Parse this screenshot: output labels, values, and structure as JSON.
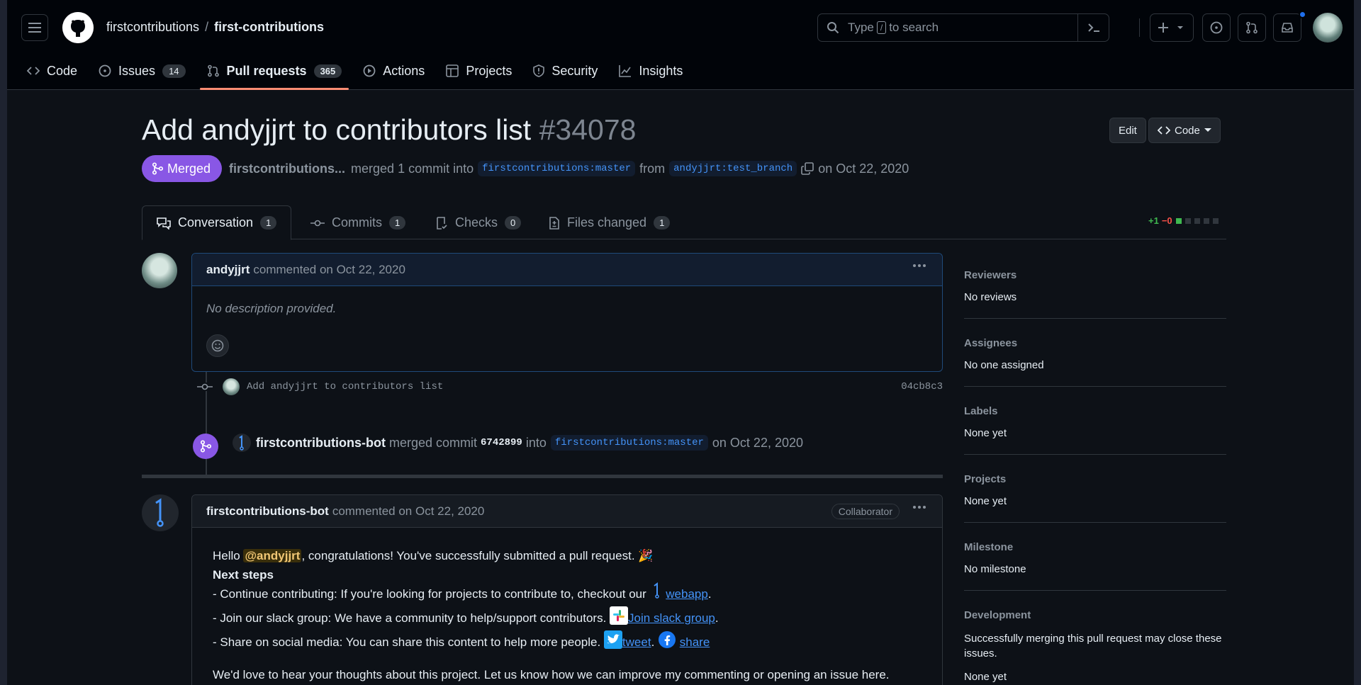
{
  "header": {
    "owner": "firstcontributions",
    "separator": "/",
    "repo": "first-contributions",
    "search_pre": "Type",
    "search_key": "/",
    "search_post": "to search"
  },
  "nav": [
    {
      "label": "Code",
      "icon": "code-icon"
    },
    {
      "label": "Issues",
      "count": "14",
      "icon": "issue-icon"
    },
    {
      "label": "Pull requests",
      "count": "365",
      "icon": "pull-request-icon",
      "active": true
    },
    {
      "label": "Actions",
      "icon": "play-icon"
    },
    {
      "label": "Projects",
      "icon": "table-icon"
    },
    {
      "label": "Security",
      "icon": "shield-icon"
    },
    {
      "label": "Insights",
      "icon": "graph-icon"
    }
  ],
  "pr": {
    "title": "Add andyjjrt to contributors list",
    "number": "#34078",
    "state": "Merged",
    "merger": "firstcontributions...",
    "merged_text": "merged 1 commit into",
    "base_branch": "firstcontributions:master",
    "from_text": "from",
    "head_branch": "andyjjrt:test_branch",
    "date_text": "on Oct 22, 2020",
    "edit_label": "Edit",
    "code_label": "Code"
  },
  "tabs": [
    {
      "label": "Conversation",
      "count": "1"
    },
    {
      "label": "Commits",
      "count": "1"
    },
    {
      "label": "Checks",
      "count": "0"
    },
    {
      "label": "Files changed",
      "count": "1"
    }
  ],
  "diffstat": {
    "plus": "+1",
    "minus": "−0",
    "added_fraction": 0.2
  },
  "comment1": {
    "author": "andyjjrt",
    "action": "commented on Oct 22, 2020",
    "body": "No description provided."
  },
  "commit": {
    "message": "Add andyjjrt to contributors list",
    "sha": "04cb8c3"
  },
  "merge_event": {
    "actor": "firstcontributions-bot",
    "text": "merged commit",
    "sha": "6742899",
    "into": "into",
    "branch": "firstcontributions:master",
    "date": "on Oct 22, 2020"
  },
  "comment2": {
    "author": "firstcontributions-bot",
    "action": "commented on Oct 22, 2020",
    "role": "Collaborator",
    "hello": "Hello",
    "mention": "@andyjjrt",
    "congrats": ", congratulations! You've successfully submitted a pull request. 🎉",
    "next_steps": "Next steps",
    "line1": "- Continue contributing: If you're looking for projects to contribute to, checkout our",
    "line1_link": "webapp",
    "line2": "- Join our slack group: We have a community to help/support contributors.",
    "line2_link": "Join slack group",
    "line3": "- Share on social media: You can share this content to help more people.",
    "line3_link1": "tweet",
    "line3_link2": "share",
    "closing": "We'd love to hear your thoughts about this project. Let us know how we can improve my commenting or opening an issue here."
  },
  "sidebar": [
    {
      "title": "Reviewers",
      "value": "No reviews"
    },
    {
      "title": "Assignees",
      "value": "No one assigned"
    },
    {
      "title": "Labels",
      "value": "None yet"
    },
    {
      "title": "Projects",
      "value": "None yet"
    },
    {
      "title": "Milestone",
      "value": "No milestone"
    },
    {
      "title": "Development",
      "value": "Successfully merging this pull request may close these issues.",
      "value2": "None yet"
    }
  ],
  "colors": {
    "merged": "#8957e5",
    "link": "#4493f8",
    "active_tab_underline": "#fd8c73"
  }
}
